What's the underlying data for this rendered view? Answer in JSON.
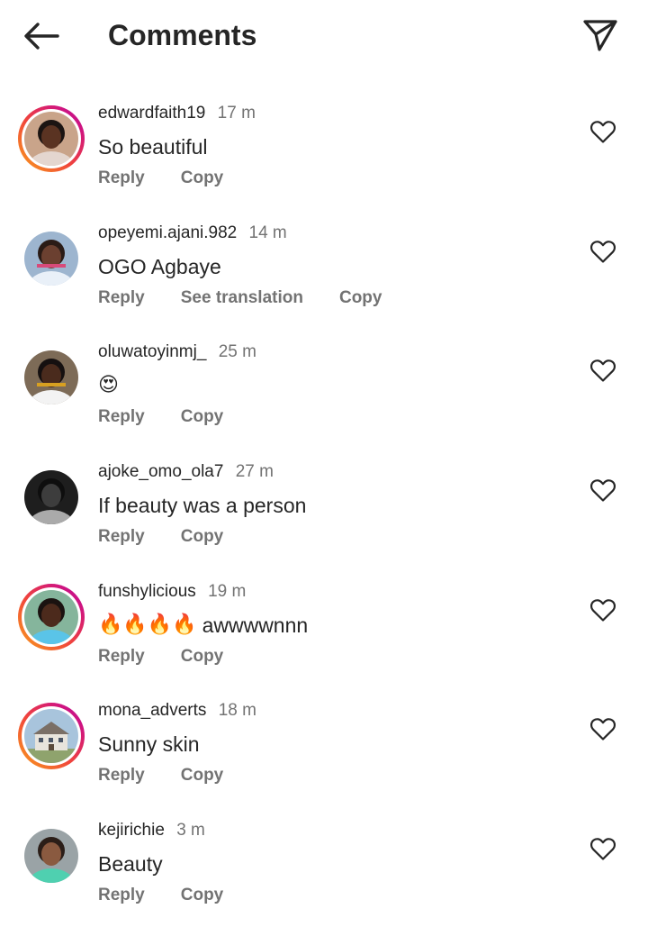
{
  "header": {
    "title": "Comments",
    "back_icon": "arrow-left-icon",
    "share_icon": "send-icon"
  },
  "comments": [
    {
      "username": "edwardfaith19",
      "time": "17 m",
      "text": "So beautiful",
      "emoji": "",
      "actions": [
        "Reply",
        "Copy"
      ],
      "story_ring": true
    },
    {
      "username": "opeyemi.ajani.982",
      "time": "14 m",
      "text": "OGO Agbaye",
      "emoji": "",
      "actions": [
        "Reply",
        "See translation",
        "Copy"
      ],
      "story_ring": false
    },
    {
      "username": "oluwatoyinmj_",
      "time": "25 m",
      "text": "",
      "emoji": "😍",
      "actions": [
        "Reply",
        "Copy"
      ],
      "story_ring": false
    },
    {
      "username": "ajoke_omo_ola7",
      "time": "27 m",
      "text": "If beauty was a person",
      "emoji": "",
      "actions": [
        "Reply",
        "Copy"
      ],
      "story_ring": false
    },
    {
      "username": "funshylicious",
      "time": "19 m",
      "text": "awwwwnnn",
      "emoji": "🔥🔥🔥🔥",
      "actions": [
        "Reply",
        "Copy"
      ],
      "story_ring": true
    },
    {
      "username": "mona_adverts",
      "time": "18 m",
      "text": "Sunny skin",
      "emoji": "",
      "actions": [
        "Reply",
        "Copy"
      ],
      "story_ring": true
    },
    {
      "username": "kejirichie",
      "time": "3 m",
      "text": "Beauty",
      "emoji": "",
      "actions": [
        "Reply",
        "Copy"
      ],
      "story_ring": false
    }
  ],
  "colors": {
    "text": "#262626",
    "secondary": "#737373",
    "ring_start": "#f9a11b",
    "ring_end": "#b3169e"
  },
  "icons": {
    "like": "heart-outline-icon"
  }
}
